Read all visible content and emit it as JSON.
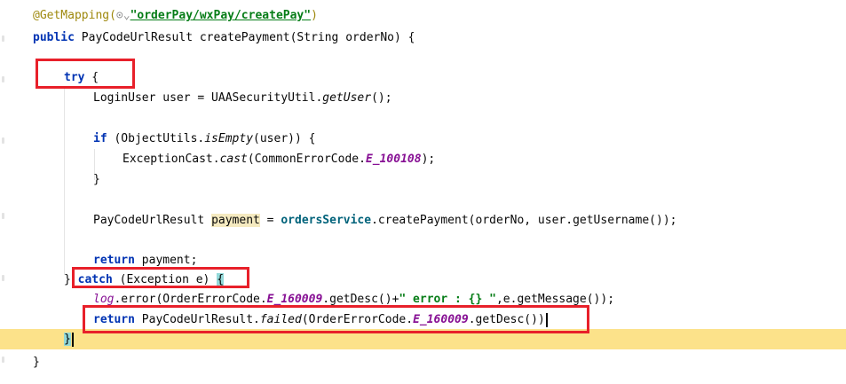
{
  "editor": {
    "lines": {
      "l1": {
        "annotation": "@GetMapping(",
        "link_icon": "⊙⌄",
        "path": "\"orderPay/wxPay/createPay\"",
        "close": ")"
      },
      "l2": {
        "kw": "public",
        "rest": " PayCodeUrlResult createPayment(String orderNo) {"
      },
      "l4": {
        "kw": "try",
        "rest": " {"
      },
      "l5": {
        "pre": "LoginUser user = UAASecurityUtil.",
        "method": "getUser",
        "post": "();"
      },
      "l7": {
        "kw": "if",
        "pre": " (ObjectUtils.",
        "method": "isEmpty",
        "post": "(user)) {"
      },
      "l8": {
        "pre": "ExceptionCast.",
        "method": "cast",
        "mid": "(CommonErrorCode.",
        "const": "E_100108",
        "post": ");"
      },
      "l9": {
        "text": "}"
      },
      "l11": {
        "pre": "PayCodeUrlResult ",
        "var": "payment",
        "mid": " = ",
        "field": "ordersService",
        "post": ".createPayment(orderNo, user.getUsername());"
      },
      "l13": {
        "kw": "return",
        "rest": " payment;"
      },
      "l14": {
        "brace": "}",
        "kw": "catch",
        "rest": " (Exception e) ",
        "open": "{"
      },
      "l15": {
        "field": "log",
        "pre": ".error(OrderErrorCode.",
        "const": "E_160009",
        "mid": ".getDesc()+",
        "str": "\" error : {} \"",
        "post": ",e.getMessage());"
      },
      "l16": {
        "kw": "return",
        "pre": " PayCodeUrlResult.",
        "method": "failed",
        "mid": "(OrderErrorCode.",
        "const": "E_160009",
        "post": ".getDesc())"
      },
      "l17": {
        "text": "}"
      },
      "l18": {
        "text": "}"
      }
    }
  }
}
